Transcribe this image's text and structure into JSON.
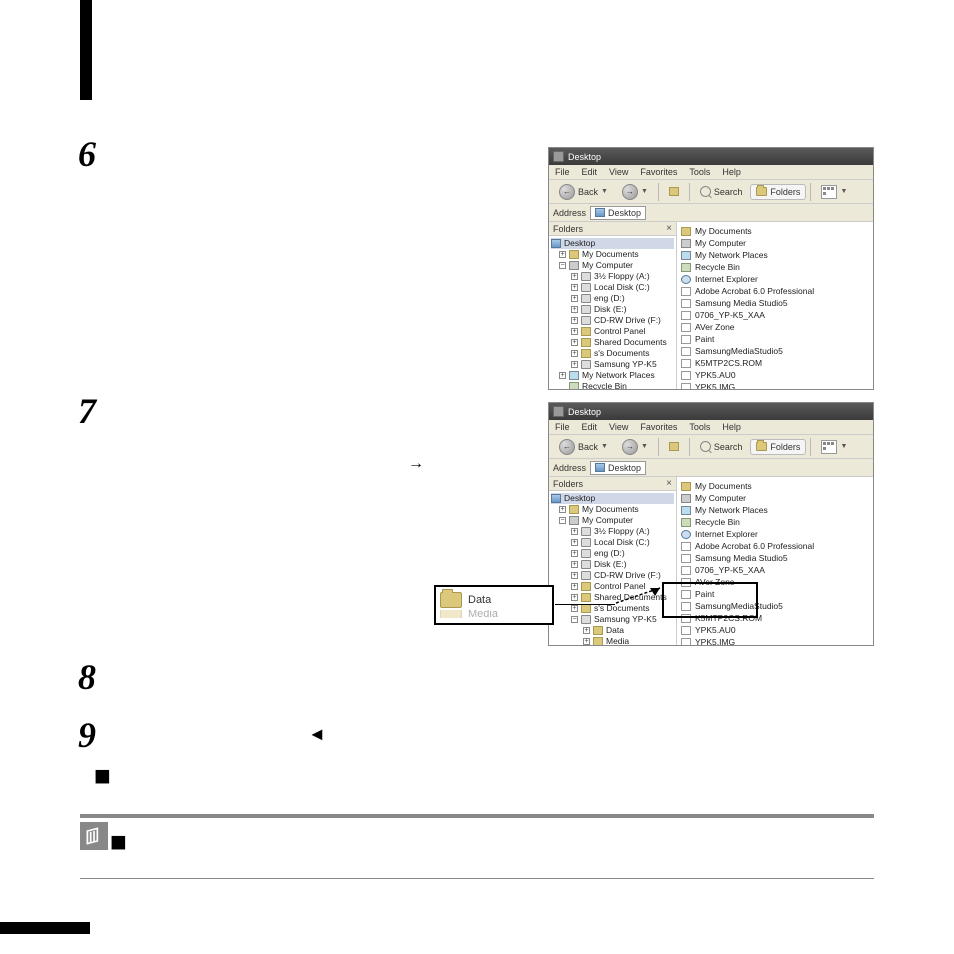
{
  "steps": {
    "s6": "6",
    "s7": "7",
    "s8": "8",
    "s9": "9"
  },
  "symbols": {
    "arrow_right": "→",
    "triangle_left": "◄",
    "bullet": "■"
  },
  "explorer": {
    "title": "Desktop",
    "menu": {
      "file": "File",
      "edit": "Edit",
      "view": "View",
      "favorites": "Favorites",
      "tools": "Tools",
      "help": "Help"
    },
    "toolbar": {
      "back": "Back",
      "search": "Search",
      "folders": "Folders"
    },
    "address_label": "Address",
    "address_value": "Desktop",
    "folders_header": "Folders",
    "tree": {
      "desktop": "Desktop",
      "my_documents": "My Documents",
      "my_computer": "My Computer",
      "floppy": "3½ Floppy (A:)",
      "local_c": "Local Disk (C:)",
      "eng_d": "eng (D:)",
      "disk_e": "Disk (E:)",
      "cdrw_f": "CD-RW Drive (F:)",
      "control_panel": "Control Panel",
      "shared_docs": "Shared Documents",
      "ss_docs": "s's Documents",
      "samsung_ypk5": "Samsung YP-K5",
      "data": "Data",
      "media": "Media",
      "my_network": "My Network Places",
      "recycle_bin": "Recycle Bin"
    },
    "content": {
      "my_documents": "My Documents",
      "my_computer": "My Computer",
      "my_network": "My Network Places",
      "recycle_bin": "Recycle Bin",
      "internet_explorer": "Internet Explorer",
      "adobe_acrobat": "Adobe Acrobat 6.0 Professional",
      "samsung_media": "Samsung Media Studio5",
      "file_0706": "0706_YP-K5_XAA",
      "aver_zone": "AVer Zone",
      "paint": "Paint",
      "samsung_media_studio5": "SamsungMediaStudio5",
      "rom1": "K5MTP2CS.ROM",
      "au0": "YPK5.AU0",
      "img": "YPK5.IMG"
    }
  },
  "callout": {
    "data": "Data",
    "media": "Media"
  }
}
